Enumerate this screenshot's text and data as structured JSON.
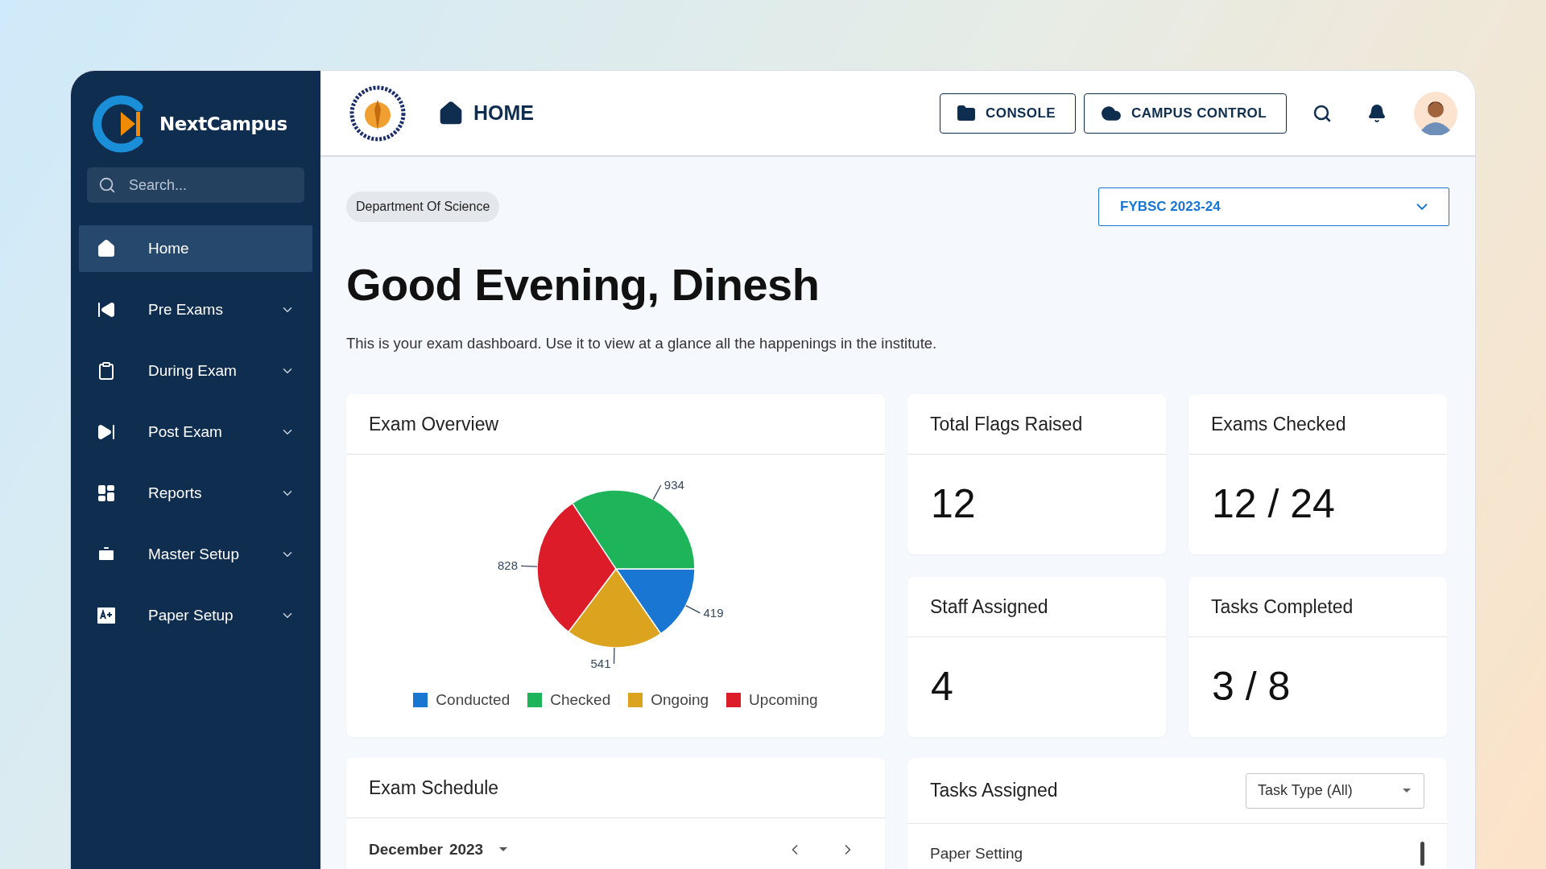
{
  "brand": {
    "name": "NextCampus"
  },
  "sidebar": {
    "search": {
      "placeholder": "Search..."
    },
    "items": [
      {
        "label": "Home",
        "selected": true,
        "expandable": false
      },
      {
        "label": "Pre Exams",
        "selected": false,
        "expandable": true
      },
      {
        "label": "During Exam",
        "selected": false,
        "expandable": true
      },
      {
        "label": "Post Exam",
        "selected": false,
        "expandable": true
      },
      {
        "label": "Reports",
        "selected": false,
        "expandable": true
      },
      {
        "label": "Master Setup",
        "selected": false,
        "expandable": true
      },
      {
        "label": "Paper Setup",
        "selected": false,
        "expandable": true
      }
    ]
  },
  "header": {
    "title": "HOME",
    "buttons": [
      {
        "label": "CONSOLE"
      },
      {
        "label": "CAMPUS CONTROL"
      }
    ]
  },
  "department": "Department Of Science",
  "year_select": {
    "value": "FYBSC 2023-24"
  },
  "greeting": "Good Evening, Dinesh",
  "description": "This is your exam dashboard. Use it to view at a glance all the happenings in the institute.",
  "overview": {
    "title": "Exam Overview",
    "chart_data": {
      "type": "pie",
      "categories": [
        "Conducted",
        "Checked",
        "Ongoing",
        "Upcoming"
      ],
      "data_labels": true,
      "legend": "bottom",
      "values": [
        419,
        934,
        541,
        828
      ],
      "colors": [
        "#1976d2",
        "#1db45a",
        "#dca31e",
        "#dc1c28"
      ]
    }
  },
  "stats": [
    {
      "title": "Total Flags Raised",
      "value": "12"
    },
    {
      "title": "Exams Checked",
      "value": "12 / 24"
    },
    {
      "title": "Staff Assigned",
      "value": "4"
    },
    {
      "title": "Tasks Completed",
      "value": "3 / 8"
    }
  ],
  "schedule": {
    "title": "Exam Schedule",
    "month": "December",
    "year": "2023"
  },
  "tasks": {
    "title": "Tasks Assigned",
    "filter": "Task Type (All)",
    "rows": [
      "Paper Setting"
    ]
  }
}
